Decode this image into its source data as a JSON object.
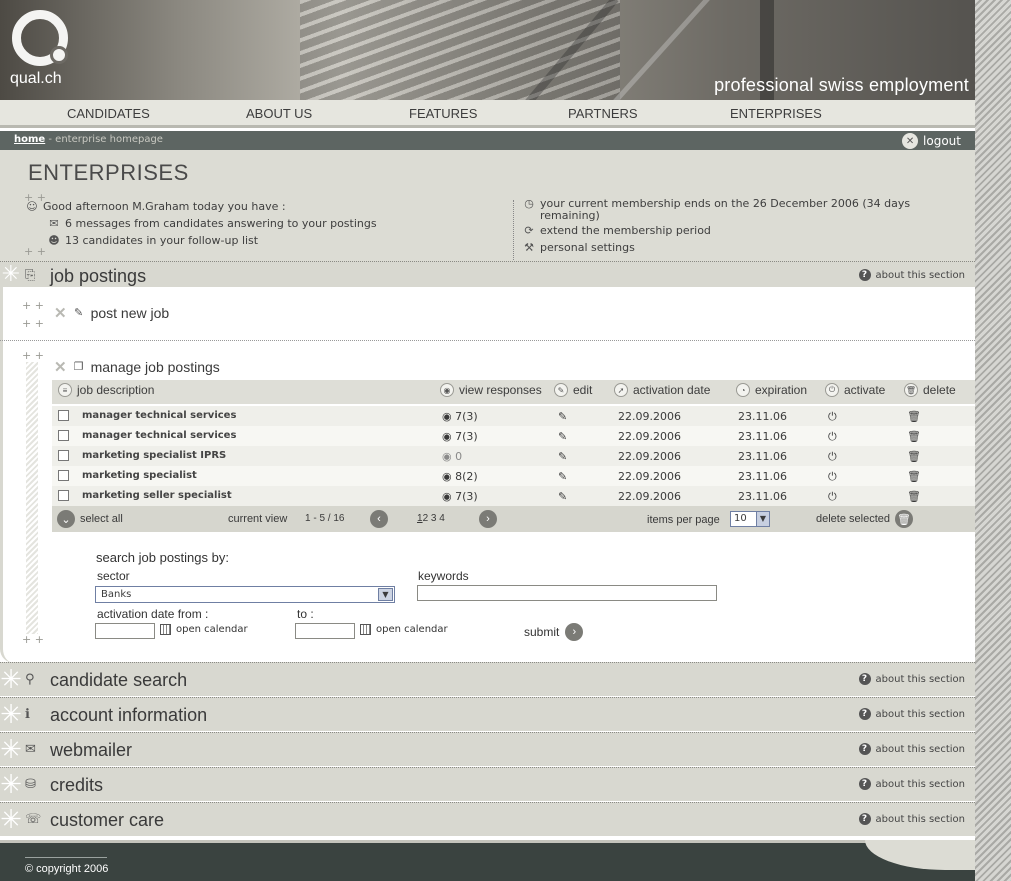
{
  "header": {
    "logo_text": "qual.ch",
    "tagline": "professional swiss employment"
  },
  "nav": {
    "items": [
      "CANDIDATES",
      "ABOUT US",
      "FEATURES",
      "PARTNERS",
      "ENTERPRISES"
    ]
  },
  "breadcrumb": {
    "home": "home",
    "current": " - enterprise homepage",
    "logout": "logout"
  },
  "summary": {
    "title": "ENTERPRISES",
    "greeting": "Good afternoon M.Graham today you have :",
    "messages": "6 messages from candidates answering to your postings",
    "followup": "13 candidates in your follow-up list",
    "membership": "your current membership ends on the 26 December 2006 (34 days",
    "membership_cont": "remaining)",
    "extend": "extend the membership period",
    "settings": "personal settings"
  },
  "sections": {
    "about_label": "about this section",
    "job_postings": "job postings",
    "candidate_search": "candidate search",
    "account_information": "account information",
    "webmailer": "webmailer",
    "credits": "credits",
    "customer_care": "customer care"
  },
  "jobs": {
    "post_new": "post new job",
    "manage": "manage job postings",
    "columns": {
      "description": "job description",
      "responses": "view responses",
      "edit": "edit",
      "activation": "activation date",
      "expiration": "expiration",
      "activate": "activate",
      "delete": "delete"
    },
    "rows": [
      {
        "description": "manager technical services",
        "responses": "7(3)",
        "activation": "22.09.2006",
        "expiration": "23.11.06"
      },
      {
        "description": "manager technical services",
        "responses": "7(3)",
        "activation": "22.09.2006",
        "expiration": "23.11.06"
      },
      {
        "description": "marketing specialist IPRS",
        "responses": "0",
        "activation": "22.09.2006",
        "expiration": "23.11.06"
      },
      {
        "description": "marketing specialist",
        "responses": "8(2)",
        "activation": "22.09.2006",
        "expiration": "23.11.06"
      },
      {
        "description": "marketing seller specialist",
        "responses": "7(3)",
        "activation": "22.09.2006",
        "expiration": "23.11.06"
      }
    ],
    "footer": {
      "select_all": "select all",
      "current_view_label": "current view",
      "current_view": "1 - 5 / 16",
      "pages": [
        "1",
        "2",
        "3",
        "4"
      ],
      "items_per_page_label": "items per page",
      "items_per_page": "10",
      "delete_selected": "delete selected"
    }
  },
  "search": {
    "title": "search job postings by:",
    "sector_label": "sector",
    "sector_value": "Banks",
    "keywords_label": "keywords",
    "keywords_value": "",
    "from_label": "activation date from :",
    "to_label": "to :",
    "from_value": "",
    "to_value": "",
    "open_calendar": "open calendar",
    "submit": "submit"
  },
  "footer": {
    "copyright": "© copyright 2006"
  }
}
